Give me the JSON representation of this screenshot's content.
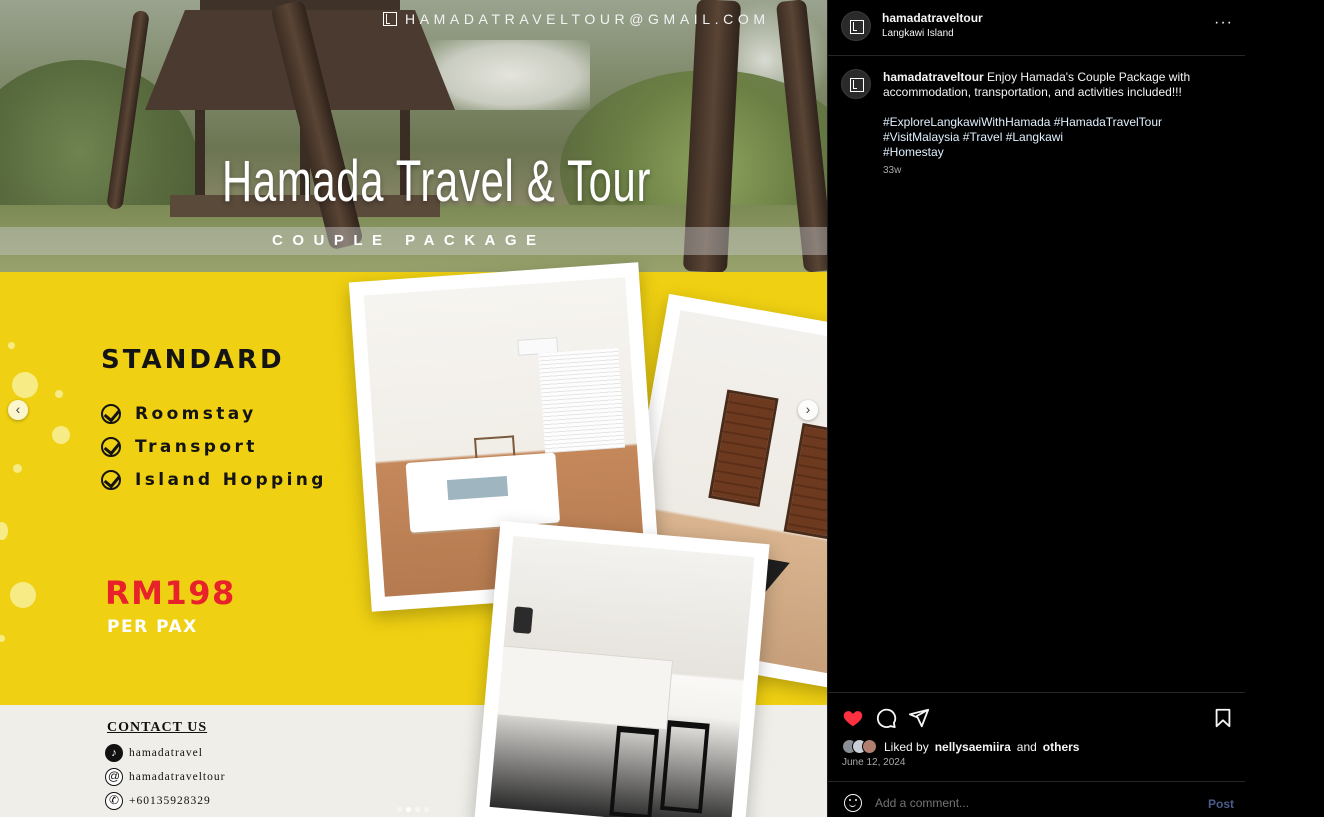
{
  "post_image": {
    "hero_email": "HAMADATRAVELTOUR@GMAIL.COM",
    "hero_title": "Hamada Travel & Tour",
    "hero_subtitle": "COUPLE PACKAGE",
    "package_title": "STANDARD",
    "features": [
      "Roomstay",
      "Transport",
      "Island Hopping"
    ],
    "price": "RM198",
    "price_unit": "PER PAX",
    "contact_title": "CONTACT US",
    "contacts": [
      {
        "icon": "tiktok-icon",
        "text": "hamadatravel"
      },
      {
        "icon": "threads-icon",
        "text": "hamadatraveltour"
      },
      {
        "icon": "whatsapp-icon",
        "text": "+60135928329"
      }
    ],
    "carousel_dots": 4,
    "carousel_active_index": 1
  },
  "panel": {
    "header": {
      "username": "hamadatraveltour",
      "location": "Langkawi Island",
      "more_label": "···"
    },
    "caption": {
      "username": "hamadatraveltour",
      "text": "Enjoy Hamada's Couple Package with accommodation, transportation, and activities included!!!",
      "hashtag_lines": [
        "#ExploreLangkawiWithHamada #HamadaTravelTour",
        "#VisitMalaysia #Travel #Langkawi",
        "#Homestay"
      ],
      "time_ago": "33w"
    },
    "actions": {
      "liked_prefix": "Liked by",
      "liked_user": "nellysaemiira",
      "liked_and": "and",
      "liked_others": "others",
      "date": "June 12, 2024",
      "like_color": "#ff3040"
    },
    "comment": {
      "placeholder": "Add a comment...",
      "post_label": "Post"
    }
  }
}
